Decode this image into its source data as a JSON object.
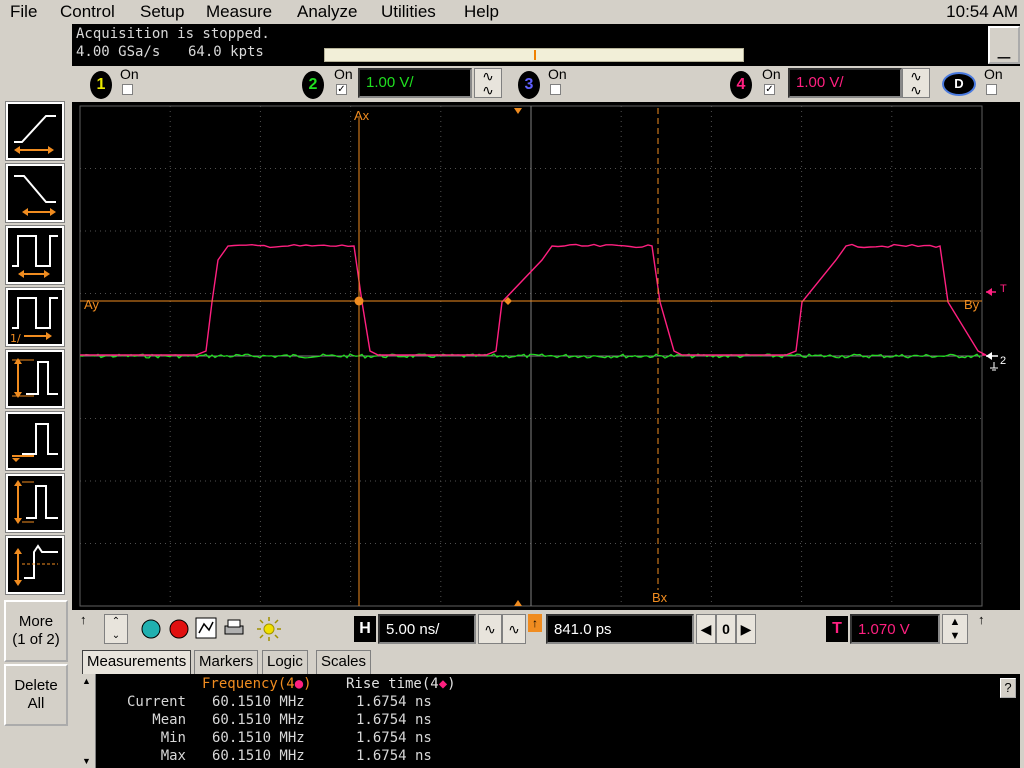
{
  "menu": [
    "File",
    "Control",
    "Setup",
    "Measure",
    "Analyze",
    "Utilities",
    "Help"
  ],
  "clock": "10:54 AM",
  "acquisition": {
    "status": "Acquisition is stopped.",
    "sample_rate": "4.00 GSa/s",
    "memory": "64.0 kpts",
    "minimize_label": "_"
  },
  "channels": [
    {
      "number": "1",
      "on_label": "On",
      "checked": false,
      "color": "#e8e800",
      "scale": ""
    },
    {
      "number": "2",
      "on_label": "On",
      "checked": true,
      "color": "#20e020",
      "scale": "1.00 V/"
    },
    {
      "number": "3",
      "on_label": "On",
      "checked": false,
      "color": "#6060ff",
      "scale": ""
    },
    {
      "number": "4",
      "on_label": "On",
      "checked": true,
      "color": "#ff2080",
      "scale": "1.00 V/"
    }
  ],
  "digital": {
    "label": "D",
    "on_label": "On",
    "checked": false
  },
  "coupling_symbol": "∿",
  "side_buttons": {
    "more": "More\n(1 of 2)",
    "delete": "Delete\nAll"
  },
  "markers": {
    "ax": "Ax",
    "bx": "Bx",
    "ay": "Ay",
    "by": "By",
    "trigger": "T",
    "ch_ref": "2"
  },
  "controls": {
    "h_label": "H",
    "timebase": "5.00 ns/",
    "position": "841.0 ps",
    "zero_label": "0",
    "t_label": "T",
    "trigger_level": "1.070 V",
    "wave_symbol": "∿"
  },
  "tabs": [
    "Measurements",
    "Markers",
    "Logic",
    "Scales"
  ],
  "measurements": {
    "col1_header": "Frequency(4",
    "col2_header": "Rise time(4",
    "rows": [
      {
        "label": "Current",
        "v1": "60.1510 MHz",
        "v2": "1.6754 ns"
      },
      {
        "label": "Mean",
        "v1": "60.1510 MHz",
        "v2": "1.6754 ns"
      },
      {
        "label": "Min",
        "v1": "60.1510 MHz",
        "v2": "1.6754 ns"
      },
      {
        "label": "Max",
        "v1": "60.1510 MHz",
        "v2": "1.6754 ns"
      }
    ],
    "help_label": "?"
  },
  "colors": {
    "ch2": "#20e020",
    "ch4": "#ff2080",
    "marker": "#f08c20",
    "grid": "#606060"
  }
}
